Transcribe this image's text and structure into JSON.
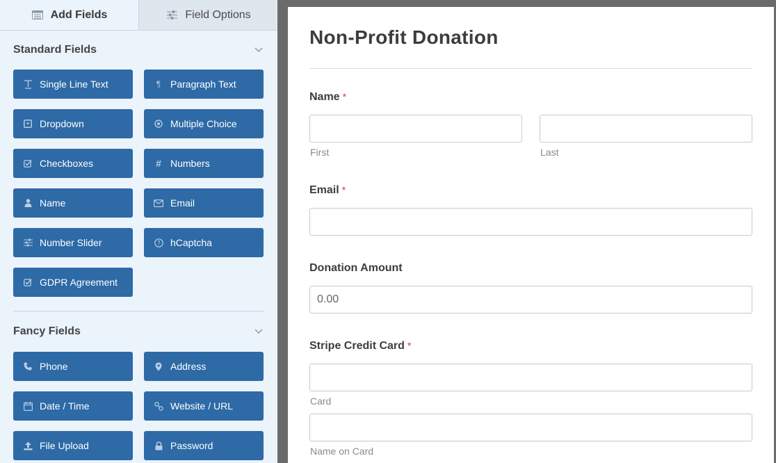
{
  "tabs": [
    {
      "label": "Add Fields",
      "icon": "list-icon",
      "active": true
    },
    {
      "label": "Field Options",
      "icon": "sliders-icon",
      "active": false
    }
  ],
  "sections": [
    {
      "title": "Standard Fields",
      "fields": [
        {
          "label": "Single Line Text",
          "icon": "text-icon"
        },
        {
          "label": "Paragraph Text",
          "icon": "paragraph-icon"
        },
        {
          "label": "Dropdown",
          "icon": "dropdown-icon"
        },
        {
          "label": "Multiple Choice",
          "icon": "radio-icon"
        },
        {
          "label": "Checkboxes",
          "icon": "checkbox-icon"
        },
        {
          "label": "Numbers",
          "icon": "hash-icon"
        },
        {
          "label": "Name",
          "icon": "user-icon"
        },
        {
          "label": "Email",
          "icon": "envelope-icon"
        },
        {
          "label": "Number Slider",
          "icon": "sliders-icon"
        },
        {
          "label": "hCaptcha",
          "icon": "question-icon"
        },
        {
          "label": "GDPR Agreement",
          "icon": "checkbox-icon"
        }
      ]
    },
    {
      "title": "Fancy Fields",
      "fields": [
        {
          "label": "Phone",
          "icon": "phone-icon"
        },
        {
          "label": "Address",
          "icon": "map-pin-icon"
        },
        {
          "label": "Date / Time",
          "icon": "calendar-icon"
        },
        {
          "label": "Website / URL",
          "icon": "link-icon"
        },
        {
          "label": "File Upload",
          "icon": "upload-icon"
        },
        {
          "label": "Password",
          "icon": "lock-icon"
        }
      ]
    }
  ],
  "form": {
    "title": "Non-Profit Donation",
    "name": {
      "label": "Name",
      "required": "*",
      "first_sublabel": "First",
      "last_sublabel": "Last",
      "first_value": "",
      "last_value": ""
    },
    "email": {
      "label": "Email",
      "required": "*",
      "value": ""
    },
    "donation": {
      "label": "Donation Amount",
      "value": "0.00"
    },
    "stripe": {
      "label": "Stripe Credit Card",
      "required": "*",
      "card_sublabel": "Card",
      "name_sublabel": "Name on Card"
    }
  },
  "colors": {
    "button_bg": "#2d6aa6",
    "sidebar_bg": "#ebf3fb",
    "required": "#d63638",
    "backdrop": "#6b6b6b"
  }
}
